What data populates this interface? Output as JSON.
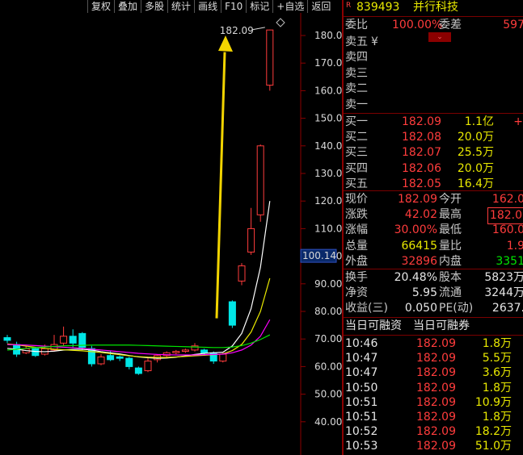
{
  "toolbar": [
    "复权",
    "叠加",
    "多股",
    "统计",
    "画线",
    "F10",
    "标记",
    "+自选",
    "返回"
  ],
  "chart_data": {
    "type": "candlestick",
    "y_ticks": [
      180.0,
      170.0,
      160.0,
      150.0,
      140.0,
      130.0,
      120.0,
      110.0,
      100.0,
      90.0,
      80.0,
      70.0,
      60.0,
      50.0,
      40.0
    ],
    "y_tick_labels": [
      "180.0",
      "170.0",
      "160.0",
      "150.0",
      "140.0",
      "130.0",
      "120.0",
      "110.0",
      "100.0",
      "90.00",
      "80.00",
      "70.00",
      "60.00",
      "50.00",
      "40.00"
    ],
    "ylim": [
      35.0,
      186.0
    ],
    "current_price_label": "100.14",
    "current_price": 100.14,
    "max_label": "182.09",
    "max_value": 182.09,
    "candles": [
      {
        "o": 70.5,
        "c": 69.5,
        "h": 71.5,
        "l": 68.5,
        "up": false
      },
      {
        "o": 68.0,
        "c": 64.5,
        "h": 69.0,
        "l": 63.5,
        "up": false
      },
      {
        "o": 65.0,
        "c": 66.5,
        "h": 67.5,
        "l": 64.5,
        "up": true
      },
      {
        "o": 66.5,
        "c": 64.0,
        "h": 67.0,
        "l": 63.5,
        "up": false
      },
      {
        "o": 64.5,
        "c": 66.5,
        "h": 68.0,
        "l": 64.0,
        "up": true
      },
      {
        "o": 66.0,
        "c": 68.0,
        "h": 71.5,
        "l": 65.5,
        "up": true
      },
      {
        "o": 68.5,
        "c": 71.0,
        "h": 74.5,
        "l": 67.5,
        "up": true
      },
      {
        "o": 71.0,
        "c": 68.5,
        "h": 73.5,
        "l": 67.0,
        "up": false
      },
      {
        "o": 72.0,
        "c": 67.0,
        "h": 72.5,
        "l": 66.0,
        "up": false
      },
      {
        "o": 66.5,
        "c": 61.0,
        "h": 67.5,
        "l": 60.0,
        "up": false
      },
      {
        "o": 61.0,
        "c": 63.5,
        "h": 64.5,
        "l": 60.5,
        "up": true
      },
      {
        "o": 64.0,
        "c": 62.5,
        "h": 65.5,
        "l": 62.0,
        "up": false
      },
      {
        "o": 63.5,
        "c": 63.0,
        "h": 64.0,
        "l": 62.0,
        "up": false
      },
      {
        "o": 63.0,
        "c": 60.0,
        "h": 63.5,
        "l": 59.0,
        "up": false
      },
      {
        "o": 59.5,
        "c": 57.5,
        "h": 60.0,
        "l": 57.0,
        "up": false
      },
      {
        "o": 58.5,
        "c": 62.0,
        "h": 63.0,
        "l": 58.0,
        "up": true
      },
      {
        "o": 62.5,
        "c": 64.0,
        "h": 64.5,
        "l": 61.5,
        "up": true
      },
      {
        "o": 64.0,
        "c": 65.0,
        "h": 65.5,
        "l": 63.5,
        "up": true
      },
      {
        "o": 65.0,
        "c": 65.5,
        "h": 66.0,
        "l": 64.5,
        "up": true
      },
      {
        "o": 65.5,
        "c": 66.0,
        "h": 66.5,
        "l": 65.0,
        "up": true
      },
      {
        "o": 66.0,
        "c": 67.5,
        "h": 68.5,
        "l": 65.5,
        "up": true
      },
      {
        "o": 66.0,
        "c": 65.0,
        "h": 66.5,
        "l": 64.0,
        "up": false
      },
      {
        "o": 65.0,
        "c": 62.0,
        "h": 65.5,
        "l": 61.0,
        "up": false
      },
      {
        "o": 62.0,
        "c": 64.5,
        "h": 65.0,
        "l": 61.5,
        "up": true
      },
      {
        "o": 83.5,
        "c": 75.0,
        "h": 84.0,
        "l": 74.0,
        "up": false
      },
      {
        "o": 91.0,
        "c": 96.5,
        "h": 97.5,
        "l": 89.5,
        "up": true
      },
      {
        "o": 101.5,
        "c": 110.0,
        "h": 117.5,
        "l": 100.5,
        "up": true
      },
      {
        "o": 115.0,
        "c": 140.0,
        "h": 140.5,
        "l": 112.5,
        "up": true
      },
      {
        "o": 162.0,
        "c": 182.0,
        "h": 182.09,
        "l": 160.0,
        "up": true
      }
    ],
    "ma_series": [
      {
        "color": "#ffffff",
        "values": [
          66.6,
          66.3,
          65.8,
          65.5,
          65.4,
          65.6,
          66.0,
          66.2,
          66.3,
          66.0,
          65.4,
          65.0,
          64.6,
          64.0,
          63.5,
          63.2,
          63.0,
          63.1,
          63.4,
          63.9,
          64.4,
          64.8,
          65.0,
          65.2,
          67.5,
          72.0,
          81.0,
          96.0,
          120.0
        ]
      },
      {
        "color": "#e8e800",
        "values": [
          68.2,
          67.9,
          67.4,
          67.0,
          66.6,
          66.3,
          66.1,
          65.9,
          65.7,
          65.4,
          65.1,
          64.7,
          64.3,
          63.9,
          63.6,
          63.4,
          63.3,
          63.3,
          63.5,
          63.7,
          63.9,
          64.1,
          64.3,
          64.6,
          65.8,
          68.0,
          72.5,
          80.0,
          92.0
        ]
      },
      {
        "color": "#ff00ff",
        "values": [
          68.0,
          67.9,
          67.8,
          67.6,
          67.4,
          67.2,
          67.0,
          66.8,
          66.6,
          66.3,
          66.0,
          65.7,
          65.4,
          65.1,
          64.8,
          64.6,
          64.4,
          64.3,
          64.2,
          64.2,
          64.2,
          64.3,
          64.4,
          64.5,
          65.0,
          66.0,
          67.8,
          71.0,
          77.0
        ]
      },
      {
        "color": "#00e600",
        "values": [
          66.0,
          66.3,
          66.6,
          66.9,
          67.1,
          67.3,
          67.5,
          67.6,
          67.7,
          67.8,
          67.8,
          67.8,
          67.8,
          67.8,
          67.7,
          67.6,
          67.5,
          67.4,
          67.3,
          67.2,
          67.1,
          67.0,
          66.9,
          66.9,
          67.1,
          67.6,
          68.5,
          69.8,
          71.5
        ]
      }
    ]
  },
  "panel": {
    "badge": "R",
    "code": "839493",
    "name": "并行科技",
    "weibi_label": "委比",
    "weibi_value": "100.00%",
    "weicha_label": "委差",
    "weicha_value": "597",
    "chevron": "⌄",
    "sell": [
      {
        "label": "卖五",
        "extra": "¥"
      },
      {
        "label": "卖四"
      },
      {
        "label": "卖三"
      },
      {
        "label": "卖二"
      },
      {
        "label": "卖一"
      }
    ],
    "buy": [
      {
        "label": "买一",
        "price": "182.09",
        "vol": "1.1亿",
        "mark": "+"
      },
      {
        "label": "买二",
        "price": "182.08",
        "vol": "20.0万"
      },
      {
        "label": "买三",
        "price": "182.07",
        "vol": "25.5万"
      },
      {
        "label": "买四",
        "price": "182.06",
        "vol": "20.0万"
      },
      {
        "label": "买五",
        "price": "182.05",
        "vol": "16.4万"
      }
    ],
    "stats1": [
      {
        "l1": "现价",
        "v1": "182.09",
        "l2": "今开",
        "v2": "162.0"
      },
      {
        "l1": "涨跌",
        "v1": "42.02",
        "l2": "最高",
        "v2": "182.0"
      },
      {
        "l1": "涨幅",
        "v1": "30.00%",
        "l2": "最低",
        "v2": "160.0"
      },
      {
        "l1": "总量",
        "v1": "66415",
        "l2": "量比",
        "v2": "1.9"
      },
      {
        "l1": "外盘",
        "v1": "32896",
        "l2": "内盘",
        "v2": "3351"
      }
    ],
    "stats2": [
      {
        "l1": "换手",
        "v1": "20.48%",
        "l2": "股本",
        "v2": "5823万"
      },
      {
        "l1": "净资",
        "v1": "5.95",
        "l2": "流通",
        "v2": "3244万"
      },
      {
        "l1": "收益(三)",
        "v1": "0.050",
        "l2": "PE(动)",
        "v2": "2637."
      }
    ],
    "margin_a": "当日可融资",
    "margin_b": "当日可融券",
    "ticks": [
      {
        "t": "10:46",
        "p": "182.09",
        "v": "1.8万"
      },
      {
        "t": "10:47",
        "p": "182.09",
        "v": "5.5万"
      },
      {
        "t": "10:47",
        "p": "182.09",
        "v": "3.6万"
      },
      {
        "t": "10:50",
        "p": "182.09",
        "v": "1.8万"
      },
      {
        "t": "10:51",
        "p": "182.09",
        "v": "10.9万"
      },
      {
        "t": "10:51",
        "p": "182.09",
        "v": "1.8万"
      },
      {
        "t": "10:52",
        "p": "182.09",
        "v": "18.2万"
      },
      {
        "t": "10:53",
        "p": "182.09",
        "v": "51.0万"
      }
    ]
  }
}
